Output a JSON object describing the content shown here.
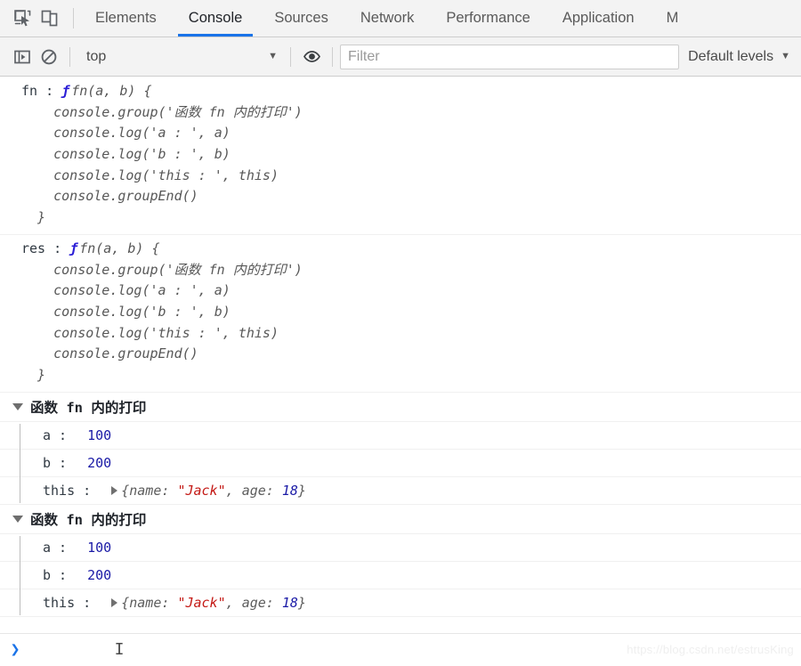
{
  "toolbar": {
    "inspect_icon": "inspect-element-icon",
    "device_icon": "device-toolbar-icon",
    "tabs": [
      {
        "label": "Elements",
        "active": false
      },
      {
        "label": "Console",
        "active": true
      },
      {
        "label": "Sources",
        "active": false
      },
      {
        "label": "Network",
        "active": false
      },
      {
        "label": "Performance",
        "active": false
      },
      {
        "label": "Application",
        "active": false
      },
      {
        "label": "M",
        "active": false
      }
    ],
    "active_tab_color": "#1a73e8"
  },
  "filterbar": {
    "sidebar_toggle_icon": "console-sidebar-icon",
    "clear_icon": "clear-console-icon",
    "context": "top",
    "context_caret": "▼",
    "eye_icon": "live-expression-eye-icon",
    "filter_placeholder": "Filter",
    "filter_value": "",
    "levels_label": "Default levels",
    "levels_caret": "▼"
  },
  "console": {
    "messages": [
      {
        "type": "code",
        "label": "fn : ",
        "fn_glyph": "ƒ",
        "signature": "fn(a, b) {",
        "body_lines": [
          "    console.group('函数 fn 内的打印')",
          "    console.log('a : ', a)",
          "    console.log('b : ', b)",
          "    console.log('this : ', this)",
          "    console.groupEnd()",
          "  }"
        ]
      },
      {
        "type": "code",
        "label": "res : ",
        "fn_glyph": "ƒ",
        "signature": "fn(a, b) {",
        "body_lines": [
          "    console.group('函数 fn 内的打印')",
          "    console.log('a : ', a)",
          "    console.log('b : ', b)",
          "    console.log('this : ', this)",
          "    console.groupEnd()",
          "  }"
        ]
      }
    ],
    "groups": [
      {
        "title": "函数 fn 内的打印",
        "rows": [
          {
            "key": "a : ",
            "kind": "number",
            "value": "100"
          },
          {
            "key": "b : ",
            "kind": "number",
            "value": "200"
          },
          {
            "key": "this : ",
            "kind": "object",
            "open_brace": "{",
            "k1": "name: ",
            "v1": "\"Jack\"",
            "comma": ", ",
            "k2": "age: ",
            "v2": "18",
            "close_brace": "}"
          }
        ]
      },
      {
        "title": "函数 fn 内的打印",
        "rows": [
          {
            "key": "a : ",
            "kind": "number",
            "value": "100"
          },
          {
            "key": "b : ",
            "kind": "number",
            "value": "200"
          },
          {
            "key": "this : ",
            "kind": "object",
            "open_brace": "{",
            "k1": "name: ",
            "v1": "\"Jack\"",
            "comma": ", ",
            "k2": "age: ",
            "v2": "18",
            "close_brace": "}"
          }
        ]
      }
    ]
  },
  "prompt": {
    "chevron": "❯",
    "input_value": "",
    "cursor_glyph": "I"
  },
  "watermark": "https://blog.csdn.net/estrusKing",
  "colors": {
    "number": "#1a1aa6",
    "string": "#c41a16",
    "keyword": "#2b1ed6",
    "accent": "#1a73e8"
  }
}
